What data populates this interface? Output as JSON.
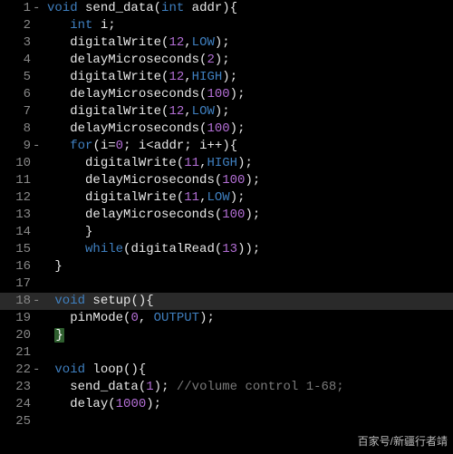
{
  "watermark": "百家号/新疆行者靖",
  "highlighted_line_index": 17,
  "lines": [
    {
      "num": 1,
      "fold": "-",
      "tokens": [
        [
          "kw",
          "void"
        ],
        [
          "pl",
          " "
        ],
        [
          "fn",
          "send_data"
        ],
        [
          "pn",
          "("
        ],
        [
          "ty",
          "int"
        ],
        [
          "pl",
          " "
        ],
        [
          "pl",
          "addr"
        ],
        [
          "pn",
          ")"
        ],
        [
          "pn",
          "{"
        ]
      ]
    },
    {
      "num": 2,
      "fold": "",
      "tokens": [
        [
          "pl",
          "   "
        ],
        [
          "ty",
          "int"
        ],
        [
          "pl",
          " "
        ],
        [
          "pl",
          "i"
        ],
        [
          "pn",
          ";"
        ]
      ]
    },
    {
      "num": 3,
      "fold": "",
      "tokens": [
        [
          "pl",
          "   "
        ],
        [
          "fn",
          "digitalWrite"
        ],
        [
          "pn",
          "("
        ],
        [
          "nm",
          "12"
        ],
        [
          "pn",
          ","
        ],
        [
          "cn",
          "LOW"
        ],
        [
          "pn",
          ")"
        ],
        [
          "pn",
          ";"
        ]
      ]
    },
    {
      "num": 4,
      "fold": "",
      "tokens": [
        [
          "pl",
          "   "
        ],
        [
          "fn",
          "delayMicroseconds"
        ],
        [
          "pn",
          "("
        ],
        [
          "nm",
          "2"
        ],
        [
          "pn",
          ")"
        ],
        [
          "pn",
          ";"
        ]
      ]
    },
    {
      "num": 5,
      "fold": "",
      "tokens": [
        [
          "pl",
          "   "
        ],
        [
          "fn",
          "digitalWrite"
        ],
        [
          "pn",
          "("
        ],
        [
          "nm",
          "12"
        ],
        [
          "pn",
          ","
        ],
        [
          "cn",
          "HIGH"
        ],
        [
          "pn",
          ")"
        ],
        [
          "pn",
          ";"
        ]
      ]
    },
    {
      "num": 6,
      "fold": "",
      "tokens": [
        [
          "pl",
          "   "
        ],
        [
          "fn",
          "delayMicroseconds"
        ],
        [
          "pn",
          "("
        ],
        [
          "nm",
          "100"
        ],
        [
          "pn",
          ")"
        ],
        [
          "pn",
          ";"
        ]
      ]
    },
    {
      "num": 7,
      "fold": "",
      "tokens": [
        [
          "pl",
          "   "
        ],
        [
          "fn",
          "digitalWrite"
        ],
        [
          "pn",
          "("
        ],
        [
          "nm",
          "12"
        ],
        [
          "pn",
          ","
        ],
        [
          "cn",
          "LOW"
        ],
        [
          "pn",
          ")"
        ],
        [
          "pn",
          ";"
        ]
      ]
    },
    {
      "num": 8,
      "fold": "",
      "tokens": [
        [
          "pl",
          "   "
        ],
        [
          "fn",
          "delayMicroseconds"
        ],
        [
          "pn",
          "("
        ],
        [
          "nm",
          "100"
        ],
        [
          "pn",
          ")"
        ],
        [
          "pn",
          ";"
        ]
      ]
    },
    {
      "num": 9,
      "fold": "-",
      "tokens": [
        [
          "pl",
          "   "
        ],
        [
          "kw",
          "for"
        ],
        [
          "pn",
          "("
        ],
        [
          "pl",
          "i"
        ],
        [
          "op",
          "="
        ],
        [
          "nm",
          "0"
        ],
        [
          "pn",
          ";"
        ],
        [
          "pl",
          " i"
        ],
        [
          "op",
          "<"
        ],
        [
          "pl",
          "addr"
        ],
        [
          "pn",
          ";"
        ],
        [
          "pl",
          " i"
        ],
        [
          "op",
          "++"
        ],
        [
          "pn",
          ")"
        ],
        [
          "pn",
          "{"
        ]
      ]
    },
    {
      "num": 10,
      "fold": "",
      "tokens": [
        [
          "pl",
          "     "
        ],
        [
          "fn",
          "digitalWrite"
        ],
        [
          "pn",
          "("
        ],
        [
          "nm",
          "11"
        ],
        [
          "pn",
          ","
        ],
        [
          "cn",
          "HIGH"
        ],
        [
          "pn",
          ")"
        ],
        [
          "pn",
          ";"
        ]
      ]
    },
    {
      "num": 11,
      "fold": "",
      "tokens": [
        [
          "pl",
          "     "
        ],
        [
          "fn",
          "delayMicroseconds"
        ],
        [
          "pn",
          "("
        ],
        [
          "nm",
          "100"
        ],
        [
          "pn",
          ")"
        ],
        [
          "pn",
          ";"
        ]
      ]
    },
    {
      "num": 12,
      "fold": "",
      "tokens": [
        [
          "pl",
          "     "
        ],
        [
          "fn",
          "digitalWrite"
        ],
        [
          "pn",
          "("
        ],
        [
          "nm",
          "11"
        ],
        [
          "pn",
          ","
        ],
        [
          "cn",
          "LOW"
        ],
        [
          "pn",
          ")"
        ],
        [
          "pn",
          ";"
        ]
      ]
    },
    {
      "num": 13,
      "fold": "",
      "tokens": [
        [
          "pl",
          "     "
        ],
        [
          "fn",
          "delayMicroseconds"
        ],
        [
          "pn",
          "("
        ],
        [
          "nm",
          "100"
        ],
        [
          "pn",
          ")"
        ],
        [
          "pn",
          ";"
        ]
      ]
    },
    {
      "num": 14,
      "fold": "",
      "tokens": [
        [
          "pl",
          "     "
        ],
        [
          "pn",
          "}"
        ]
      ]
    },
    {
      "num": 15,
      "fold": "",
      "tokens": [
        [
          "pl",
          "     "
        ],
        [
          "kw",
          "while"
        ],
        [
          "pn",
          "("
        ],
        [
          "fn",
          "digitalRead"
        ],
        [
          "pn",
          "("
        ],
        [
          "nm",
          "13"
        ],
        [
          "pn",
          ")"
        ],
        [
          "pn",
          ")"
        ],
        [
          "pn",
          ";"
        ]
      ]
    },
    {
      "num": 16,
      "fold": "",
      "tokens": [
        [
          "pl",
          " "
        ],
        [
          "pn",
          "}"
        ]
      ]
    },
    {
      "num": 17,
      "fold": "",
      "tokens": []
    },
    {
      "num": 18,
      "fold": "-",
      "tokens": [
        [
          "pl",
          " "
        ],
        [
          "kw",
          "void"
        ],
        [
          "pl",
          " "
        ],
        [
          "fn",
          "setup"
        ],
        [
          "pn",
          "("
        ],
        [
          "pn",
          ")"
        ],
        [
          "pn",
          "{"
        ]
      ]
    },
    {
      "num": 19,
      "fold": "",
      "tokens": [
        [
          "pl",
          "   "
        ],
        [
          "fn",
          "pinMode"
        ],
        [
          "pn",
          "("
        ],
        [
          "nm",
          "0"
        ],
        [
          "pn",
          ","
        ],
        [
          "pl",
          " "
        ],
        [
          "cn",
          "OUTPUT"
        ],
        [
          "pn",
          ")"
        ],
        [
          "pn",
          ";"
        ]
      ]
    },
    {
      "num": 20,
      "fold": "",
      "tokens": [
        [
          "pl",
          " "
        ],
        [
          "br",
          "}"
        ]
      ]
    },
    {
      "num": 21,
      "fold": "",
      "tokens": []
    },
    {
      "num": 22,
      "fold": "-",
      "tokens": [
        [
          "pl",
          " "
        ],
        [
          "kw",
          "void"
        ],
        [
          "pl",
          " "
        ],
        [
          "fn",
          "loop"
        ],
        [
          "pn",
          "("
        ],
        [
          "pn",
          ")"
        ],
        [
          "pn",
          "{"
        ]
      ]
    },
    {
      "num": 23,
      "fold": "",
      "tokens": [
        [
          "pl",
          "   "
        ],
        [
          "fn",
          "send_data"
        ],
        [
          "pn",
          "("
        ],
        [
          "nm",
          "1"
        ],
        [
          "pn",
          ")"
        ],
        [
          "pn",
          ";"
        ],
        [
          "pl",
          " "
        ],
        [
          "cm",
          "//volume control 1-68;"
        ]
      ]
    },
    {
      "num": 24,
      "fold": "",
      "tokens": [
        [
          "pl",
          "   "
        ],
        [
          "fn",
          "delay"
        ],
        [
          "pn",
          "("
        ],
        [
          "nm",
          "1000"
        ],
        [
          "pn",
          ")"
        ],
        [
          "pn",
          ";"
        ]
      ]
    },
    {
      "num": 25,
      "fold": "",
      "tokens": []
    }
  ]
}
